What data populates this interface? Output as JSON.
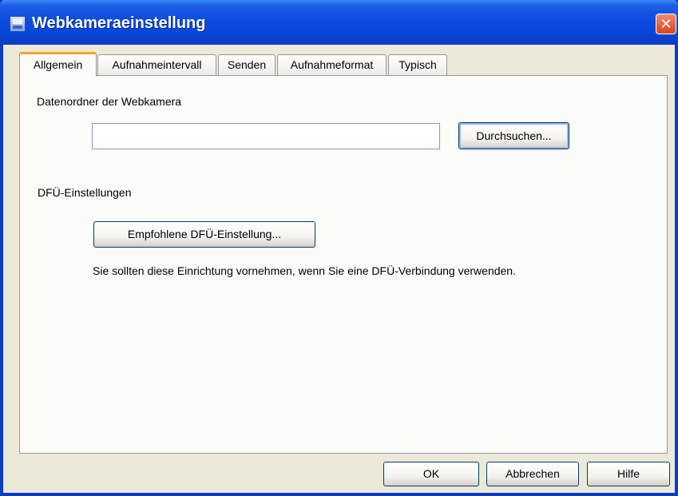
{
  "window": {
    "title": "Webkameraeinstellung",
    "close_glyph": "✕"
  },
  "tabs": [
    {
      "label": "Allgemein",
      "active": true
    },
    {
      "label": "Aufnahmeintervall",
      "active": false
    },
    {
      "label": "Senden",
      "active": false
    },
    {
      "label": "Aufnahmeformat",
      "active": false
    },
    {
      "label": "Typisch",
      "active": false
    }
  ],
  "general": {
    "folder_section_label": "Datenordner der Webkamera",
    "folder_input_value": "",
    "browse_button": "Durchsuchen...",
    "dialup_section_label": "DFÜ-Einstellungen",
    "dialup_button": "Empfohlene DFÜ-Einstellung...",
    "dialup_description": "Sie sollten diese Einrichtung vornehmen, wenn Sie eine DFÜ-Verbindung verwenden."
  },
  "footer": {
    "ok": "OK",
    "cancel": "Abbrechen",
    "help": "Hilfe"
  },
  "colors": {
    "title_bar": "#0a45d8",
    "dialog_bg": "#ece9d8",
    "active_tab_accent": "#f5a623",
    "close_button": "#d8451c"
  },
  "icons": {
    "app": "webcam-settings-icon",
    "close": "close-icon"
  }
}
